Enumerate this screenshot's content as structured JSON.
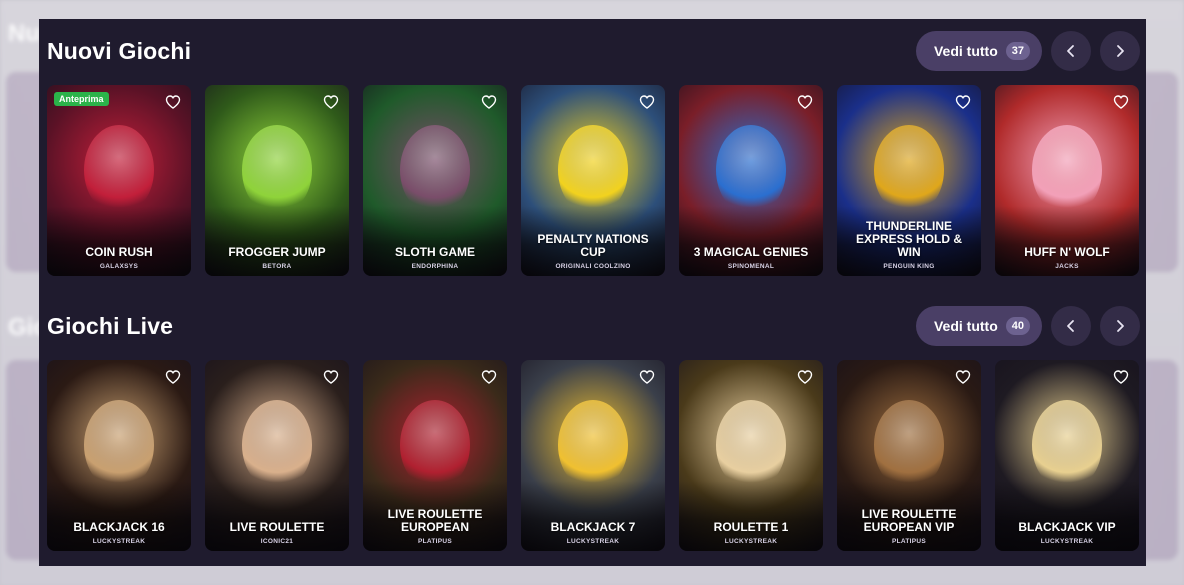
{
  "sections": [
    {
      "title": "Nuovi Giochi",
      "see_all_label": "Vedi tutto",
      "count": "37",
      "cards": [
        {
          "title": "COIN RUSH",
          "provider": "GALAXSYS",
          "badge": "Anteprima",
          "bg": "#5a1226",
          "accent": "#c21f3a"
        },
        {
          "title": "FROGGER JUMP",
          "provider": "BETORA",
          "bg": "#2f5a1a",
          "accent": "#8fd33a"
        },
        {
          "title": "SLOTH GAME",
          "provider": "ENDORPHINA",
          "bg": "#1f5a2a",
          "accent": "#7a4d6a"
        },
        {
          "title": "PENALTY NATIONS CUP",
          "provider": "ORIGINALI COOLZINO",
          "bg": "#2d4f7a",
          "accent": "#f2d21e"
        },
        {
          "title": "3 MAGICAL GENIES",
          "provider": "SPINOMENAL",
          "bg": "#7a1e28",
          "accent": "#2a6fd0"
        },
        {
          "title": "THUNDERLINE EXPRESS HOLD & WIN",
          "provider": "PENGUIN KING",
          "bg": "#1a2f8a",
          "accent": "#e0a71a"
        },
        {
          "title": "HUFF N' WOLF",
          "provider": "JACKS",
          "bg": "#b02a2a",
          "accent": "#f2a0b8"
        }
      ]
    },
    {
      "title": "Giochi Live",
      "see_all_label": "Vedi tutto",
      "count": "40",
      "cards": [
        {
          "title": "BLACKJACK 16",
          "provider": "LUCKYSTREAK",
          "bg": "#2b1a14",
          "accent": "#c9a070"
        },
        {
          "title": "LIVE ROULETTE",
          "provider": "ICONIC21",
          "bg": "#2a1f1c",
          "accent": "#d9b08c"
        },
        {
          "title": "LIVE ROULETTE EUROPEAN",
          "provider": "PLATIPUS",
          "bg": "#3a2a1a",
          "accent": "#b02030"
        },
        {
          "title": "BLACKJACK 7",
          "provider": "LUCKYSTREAK",
          "bg": "#3a3f4a",
          "accent": "#f0c030"
        },
        {
          "title": "ROULETTE 1",
          "provider": "LUCKYSTREAK",
          "bg": "#4a3a1a",
          "accent": "#e8cfa0"
        },
        {
          "title": "LIVE ROULETTE EUROPEAN VIP",
          "provider": "PLATIPUS",
          "bg": "#2a1a14",
          "accent": "#a07040"
        },
        {
          "title": "BLACKJACK VIP",
          "provider": "LUCKYSTREAK",
          "bg": "#1e1a22",
          "accent": "#e8d090"
        }
      ]
    }
  ],
  "background_titles": [
    "Nu",
    "Gio"
  ]
}
